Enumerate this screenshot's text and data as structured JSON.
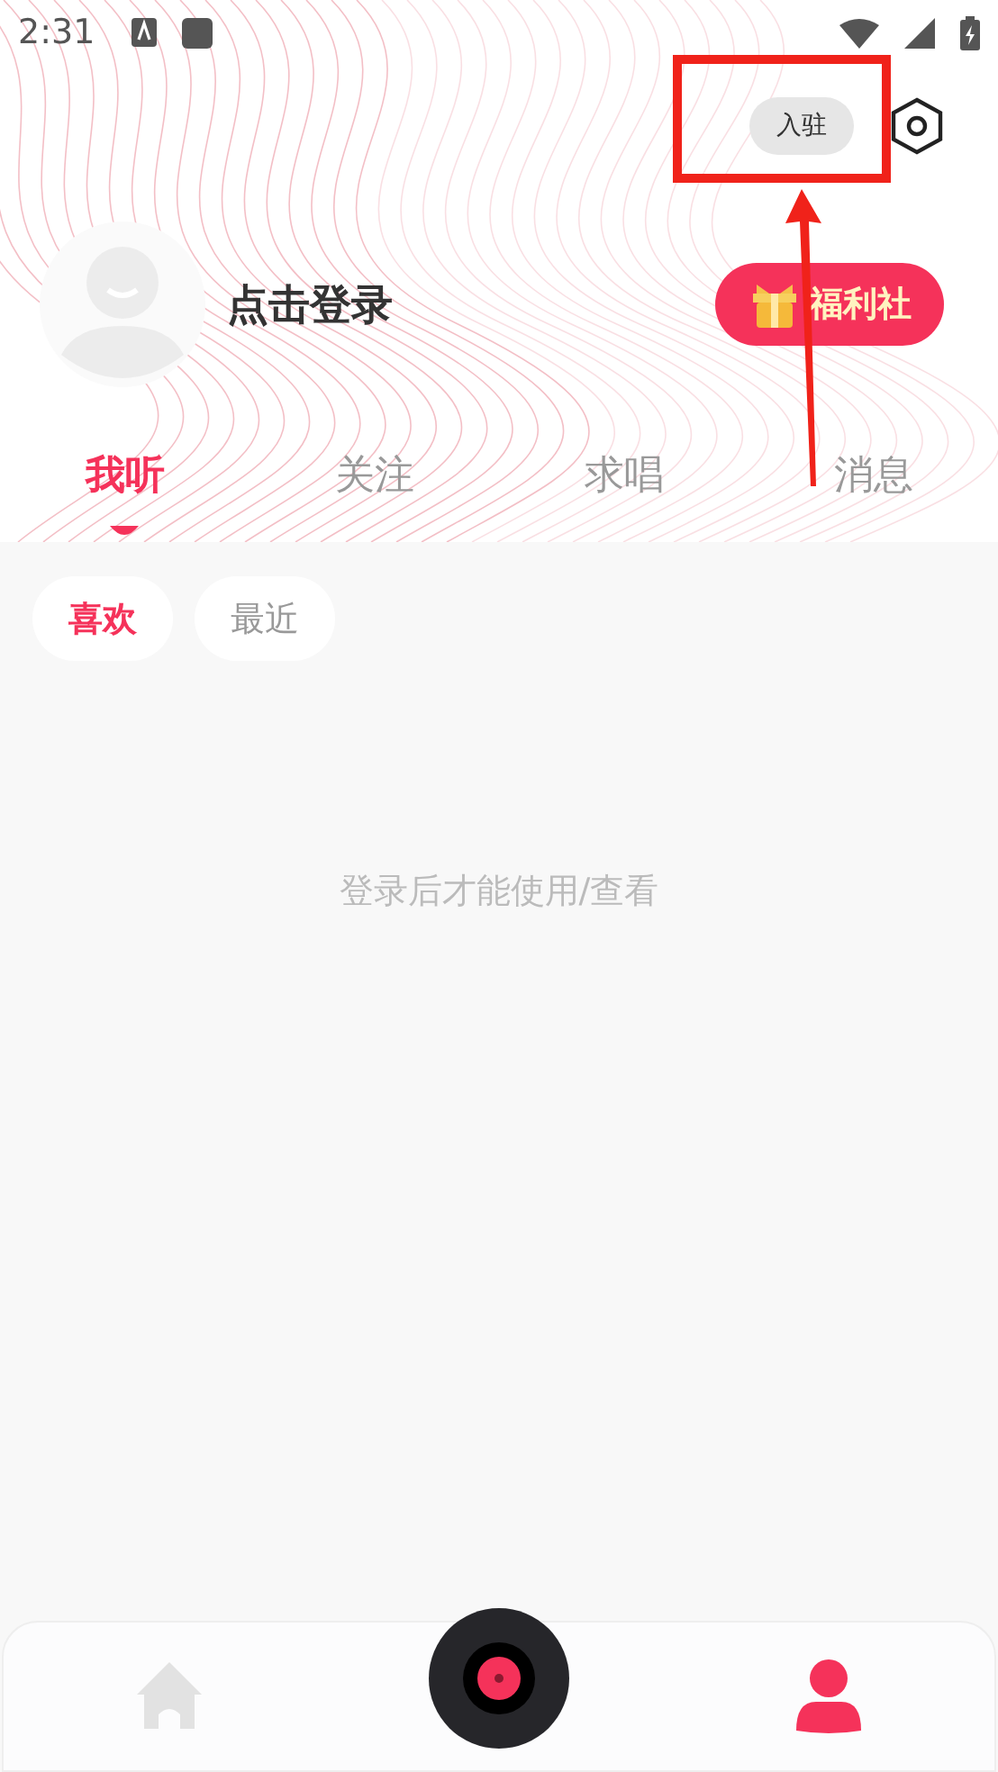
{
  "status_bar": {
    "time": "2:31"
  },
  "header": {
    "join_button": "入驻",
    "login_prompt": "点击登录",
    "welfare_button": "福利社"
  },
  "tabs": [
    {
      "label": "我听",
      "selected": true
    },
    {
      "label": "关注",
      "selected": false
    },
    {
      "label": "求唱",
      "selected": false
    },
    {
      "label": "消息",
      "selected": false
    }
  ],
  "filters": [
    {
      "label": "喜欢",
      "selected": true
    },
    {
      "label": "最近",
      "selected": false
    }
  ],
  "empty_message": "登录后才能使用/查看",
  "bottom_nav": [
    {
      "kind": "home",
      "selected": false
    },
    {
      "kind": "player",
      "selected": false
    },
    {
      "kind": "profile",
      "selected": true
    }
  ]
}
